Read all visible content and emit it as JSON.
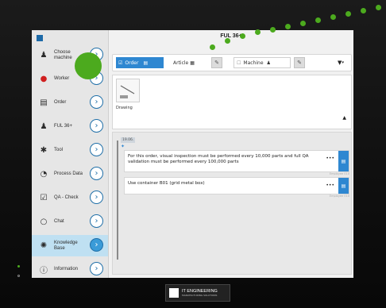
{
  "header": {
    "title": "FUL 36+"
  },
  "sidebar": {
    "items": [
      {
        "label": "Choose machine",
        "icon": "machine-icon"
      },
      {
        "label": "Worker",
        "icon": "worker-icon"
      },
      {
        "label": "Order",
        "icon": "order-icon"
      },
      {
        "label": "FUL 36+",
        "icon": "machine-icon"
      },
      {
        "label": "Tool",
        "icon": "gear-icon"
      },
      {
        "label": "Process Data",
        "icon": "dial-icon"
      },
      {
        "label": "QA - Check",
        "icon": "checklist-icon"
      },
      {
        "label": "Chat",
        "icon": "chat-icon"
      },
      {
        "label": "Knowledge Base",
        "icon": "bulb-icon"
      },
      {
        "label": "Information",
        "icon": "info-icon"
      }
    ]
  },
  "toolbar": {
    "order_label": "Order",
    "article_label": "Article",
    "machine_label": "Machine"
  },
  "drawing": {
    "label": "Drawing"
  },
  "notes": [
    {
      "text": "For this order, visual inspection must be performed every 10,000 parts and full QA validation must be performed every 100,000 parts",
      "author": "Employee 010"
    },
    {
      "text": "Use container B01 (grid metal box)",
      "author": "Employee 010"
    }
  ],
  "timeline": {
    "date": "19.06."
  },
  "branding": {
    "logo_text": "IT ENGINEERING",
    "logo_sub": "MANUFACTURING SOLUTIONS"
  },
  "colors": {
    "accent": "#2e87d1",
    "highlight": "#4caa1e",
    "active_sidebar": "#bfe0f2"
  }
}
